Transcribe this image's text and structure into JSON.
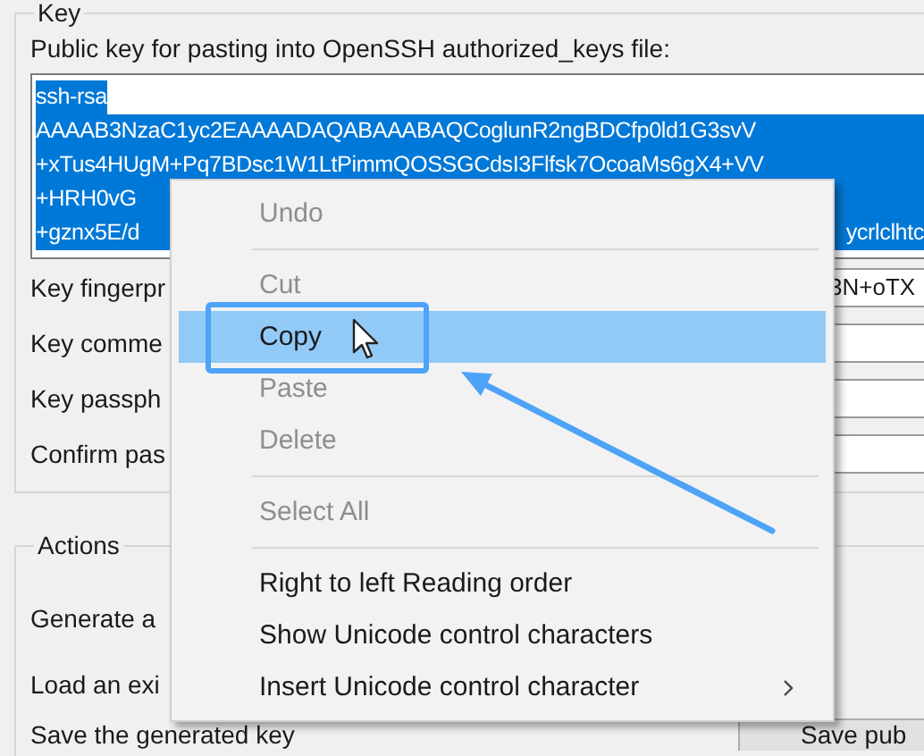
{
  "key_group": {
    "label": "Key",
    "public_key_label": "Public key for pasting into OpenSSH authorized_keys file:",
    "public_key": {
      "selected": true,
      "lines": [
        {
          "text": "ssh-rsa"
        },
        {
          "text": "AAAAB3NzaC1yc2EAAAADAQABAAABAQCoglunR2ngBDCfp0ld1G3svV"
        },
        {
          "text": "+xTus4HUgM+Pq7BDsc1W1LtPimmQOSSGCdsI3Flfsk7OcoaMs6gX4+VV"
        },
        {
          "text": "+HRH0vG"
        },
        {
          "text": "+gznx5E/d",
          "tail": "ycrlclhtc"
        }
      ]
    },
    "fields": [
      {
        "label": "Key fingerpr",
        "value": "3N+oTX"
      },
      {
        "label": "Key comme"
      },
      {
        "label": "Key passph"
      },
      {
        "label": "Confirm pas"
      }
    ]
  },
  "actions_group": {
    "label": "Actions",
    "rows": [
      {
        "label": "Generate a"
      },
      {
        "label": "Load an exi"
      },
      {
        "label": "Save the generated key",
        "button": "Save pub"
      }
    ]
  },
  "context_menu": {
    "items": [
      {
        "kind": "item",
        "label": "Undo",
        "disabled": true,
        "selected": false
      },
      {
        "kind": "separator"
      },
      {
        "kind": "item",
        "label": "Cut",
        "disabled": true,
        "selected": false
      },
      {
        "kind": "item",
        "label": "Copy",
        "disabled": false,
        "selected": true
      },
      {
        "kind": "item",
        "label": "Paste",
        "disabled": true,
        "selected": false
      },
      {
        "kind": "item",
        "label": "Delete",
        "disabled": true,
        "selected": false
      },
      {
        "kind": "separator"
      },
      {
        "kind": "item",
        "label": "Select All",
        "disabled": true,
        "selected": false
      },
      {
        "kind": "separator"
      },
      {
        "kind": "item",
        "label": "Right to left Reading order",
        "disabled": false,
        "selected": false
      },
      {
        "kind": "item",
        "label": "Show Unicode control characters",
        "disabled": false,
        "selected": false
      },
      {
        "kind": "item",
        "label": "Insert Unicode control character",
        "disabled": false,
        "selected": false,
        "submenu": true
      }
    ]
  }
}
